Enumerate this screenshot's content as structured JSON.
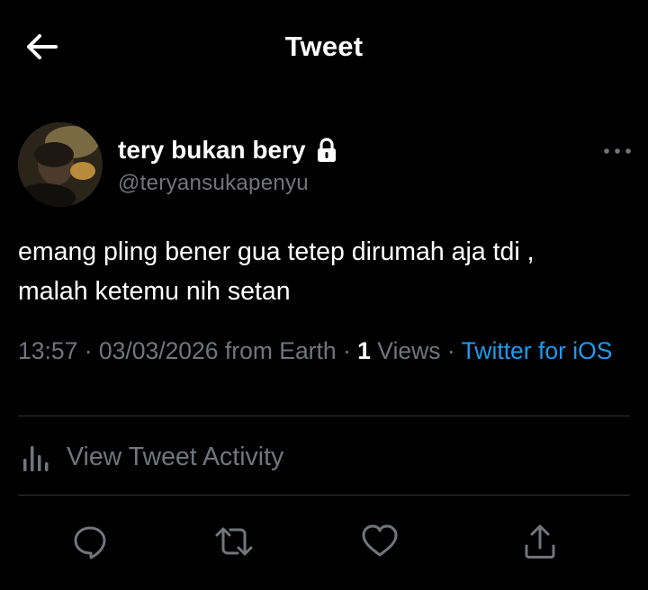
{
  "header": {
    "title": "Tweet",
    "back_icon": "arrow-left-icon"
  },
  "tweet": {
    "author": {
      "display_name": "tery bukan bery",
      "handle": "@teryansukapenyu",
      "protected_icon": "lock-icon",
      "avatar": "profile-photo"
    },
    "text_lines": [
      "emang pling bener gua tetep dirumah aja tdi ,",
      "malah ketemu nih setan"
    ],
    "meta": {
      "time": "13:57",
      "date": "03/03/2026",
      "location": "from Earth",
      "separator": " · ",
      "views_count": "1",
      "views_label": " Views",
      "source": "Twitter for iOS"
    }
  },
  "activity": {
    "label": "View Tweet Activity",
    "icon": "bar-chart-icon"
  },
  "actions": [
    {
      "name": "reply",
      "icon": "speech-bubble-icon"
    },
    {
      "name": "retweet",
      "icon": "retweet-arrows-icon"
    },
    {
      "name": "like",
      "icon": "heart-icon"
    },
    {
      "name": "share",
      "icon": "share-upload-icon"
    }
  ],
  "colors": {
    "background": "#000000",
    "text_primary": "#ffffff",
    "text_secondary": "#71767b",
    "link": "#1d9bf0",
    "divider": "#2f3336"
  }
}
